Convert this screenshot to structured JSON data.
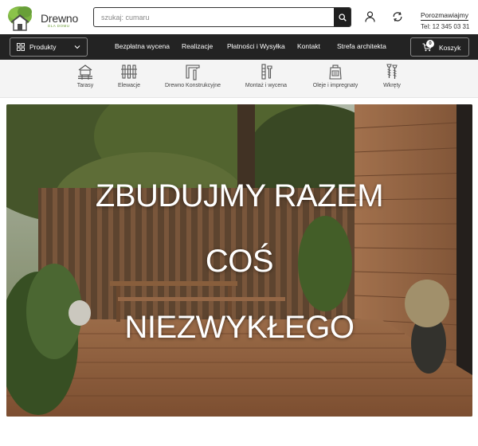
{
  "brand": {
    "name": "Drewno",
    "tagline": "DLA DOMU"
  },
  "search": {
    "placeholder": "szukaj: cumaru"
  },
  "header": {
    "contact_title": "Porozmawiajmy",
    "contact_phone": "Tel: 12 345 03 31"
  },
  "nav": {
    "products_label": "Produkty",
    "links": [
      "Bezpłatna wycena",
      "Realizacje",
      "Płatności i Wysyłka",
      "Kontakt",
      "Strefa architekta"
    ],
    "cart_label": "Koszyk",
    "cart_count": "0"
  },
  "categories": [
    {
      "label": "Tarasy",
      "icon": "deck-icon"
    },
    {
      "label": "Elewacje",
      "icon": "facade-icon"
    },
    {
      "label": "Drewno Konstrukcyjne",
      "icon": "timber-icon"
    },
    {
      "label": "Montaż i wycena",
      "icon": "tools-icon"
    },
    {
      "label": "Oleje i impregnaty",
      "icon": "oil-can-icon"
    },
    {
      "label": "Wkręty",
      "icon": "screw-icon"
    }
  ],
  "hero": {
    "line1": "ZBUDUJMY RAZEM",
    "line2": "COŚ",
    "line3": "NIEZWYKŁEGO"
  },
  "colors": {
    "navbar": "#232323",
    "brand_green": "#6a9b35",
    "category_bg": "#f4f4f4",
    "wood": "#a06a45"
  }
}
